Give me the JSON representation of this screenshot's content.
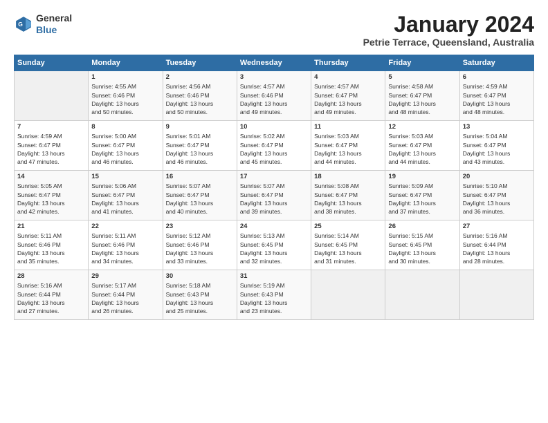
{
  "header": {
    "logo_line1": "General",
    "logo_line2": "Blue",
    "month_title": "January 2024",
    "location": "Petrie Terrace, Queensland, Australia"
  },
  "days_of_week": [
    "Sunday",
    "Monday",
    "Tuesday",
    "Wednesday",
    "Thursday",
    "Friday",
    "Saturday"
  ],
  "weeks": [
    [
      {
        "day": "",
        "info": ""
      },
      {
        "day": "1",
        "info": "Sunrise: 4:55 AM\nSunset: 6:46 PM\nDaylight: 13 hours\nand 50 minutes."
      },
      {
        "day": "2",
        "info": "Sunrise: 4:56 AM\nSunset: 6:46 PM\nDaylight: 13 hours\nand 50 minutes."
      },
      {
        "day": "3",
        "info": "Sunrise: 4:57 AM\nSunset: 6:46 PM\nDaylight: 13 hours\nand 49 minutes."
      },
      {
        "day": "4",
        "info": "Sunrise: 4:57 AM\nSunset: 6:47 PM\nDaylight: 13 hours\nand 49 minutes."
      },
      {
        "day": "5",
        "info": "Sunrise: 4:58 AM\nSunset: 6:47 PM\nDaylight: 13 hours\nand 48 minutes."
      },
      {
        "day": "6",
        "info": "Sunrise: 4:59 AM\nSunset: 6:47 PM\nDaylight: 13 hours\nand 48 minutes."
      }
    ],
    [
      {
        "day": "7",
        "info": "Sunrise: 4:59 AM\nSunset: 6:47 PM\nDaylight: 13 hours\nand 47 minutes."
      },
      {
        "day": "8",
        "info": "Sunrise: 5:00 AM\nSunset: 6:47 PM\nDaylight: 13 hours\nand 46 minutes."
      },
      {
        "day": "9",
        "info": "Sunrise: 5:01 AM\nSunset: 6:47 PM\nDaylight: 13 hours\nand 46 minutes."
      },
      {
        "day": "10",
        "info": "Sunrise: 5:02 AM\nSunset: 6:47 PM\nDaylight: 13 hours\nand 45 minutes."
      },
      {
        "day": "11",
        "info": "Sunrise: 5:03 AM\nSunset: 6:47 PM\nDaylight: 13 hours\nand 44 minutes."
      },
      {
        "day": "12",
        "info": "Sunrise: 5:03 AM\nSunset: 6:47 PM\nDaylight: 13 hours\nand 44 minutes."
      },
      {
        "day": "13",
        "info": "Sunrise: 5:04 AM\nSunset: 6:47 PM\nDaylight: 13 hours\nand 43 minutes."
      }
    ],
    [
      {
        "day": "14",
        "info": "Sunrise: 5:05 AM\nSunset: 6:47 PM\nDaylight: 13 hours\nand 42 minutes."
      },
      {
        "day": "15",
        "info": "Sunrise: 5:06 AM\nSunset: 6:47 PM\nDaylight: 13 hours\nand 41 minutes."
      },
      {
        "day": "16",
        "info": "Sunrise: 5:07 AM\nSunset: 6:47 PM\nDaylight: 13 hours\nand 40 minutes."
      },
      {
        "day": "17",
        "info": "Sunrise: 5:07 AM\nSunset: 6:47 PM\nDaylight: 13 hours\nand 39 minutes."
      },
      {
        "day": "18",
        "info": "Sunrise: 5:08 AM\nSunset: 6:47 PM\nDaylight: 13 hours\nand 38 minutes."
      },
      {
        "day": "19",
        "info": "Sunrise: 5:09 AM\nSunset: 6:47 PM\nDaylight: 13 hours\nand 37 minutes."
      },
      {
        "day": "20",
        "info": "Sunrise: 5:10 AM\nSunset: 6:47 PM\nDaylight: 13 hours\nand 36 minutes."
      }
    ],
    [
      {
        "day": "21",
        "info": "Sunrise: 5:11 AM\nSunset: 6:46 PM\nDaylight: 13 hours\nand 35 minutes."
      },
      {
        "day": "22",
        "info": "Sunrise: 5:11 AM\nSunset: 6:46 PM\nDaylight: 13 hours\nand 34 minutes."
      },
      {
        "day": "23",
        "info": "Sunrise: 5:12 AM\nSunset: 6:46 PM\nDaylight: 13 hours\nand 33 minutes."
      },
      {
        "day": "24",
        "info": "Sunrise: 5:13 AM\nSunset: 6:45 PM\nDaylight: 13 hours\nand 32 minutes."
      },
      {
        "day": "25",
        "info": "Sunrise: 5:14 AM\nSunset: 6:45 PM\nDaylight: 13 hours\nand 31 minutes."
      },
      {
        "day": "26",
        "info": "Sunrise: 5:15 AM\nSunset: 6:45 PM\nDaylight: 13 hours\nand 30 minutes."
      },
      {
        "day": "27",
        "info": "Sunrise: 5:16 AM\nSunset: 6:44 PM\nDaylight: 13 hours\nand 28 minutes."
      }
    ],
    [
      {
        "day": "28",
        "info": "Sunrise: 5:16 AM\nSunset: 6:44 PM\nDaylight: 13 hours\nand 27 minutes."
      },
      {
        "day": "29",
        "info": "Sunrise: 5:17 AM\nSunset: 6:44 PM\nDaylight: 13 hours\nand 26 minutes."
      },
      {
        "day": "30",
        "info": "Sunrise: 5:18 AM\nSunset: 6:43 PM\nDaylight: 13 hours\nand 25 minutes."
      },
      {
        "day": "31",
        "info": "Sunrise: 5:19 AM\nSunset: 6:43 PM\nDaylight: 13 hours\nand 23 minutes."
      },
      {
        "day": "",
        "info": ""
      },
      {
        "day": "",
        "info": ""
      },
      {
        "day": "",
        "info": ""
      }
    ]
  ]
}
